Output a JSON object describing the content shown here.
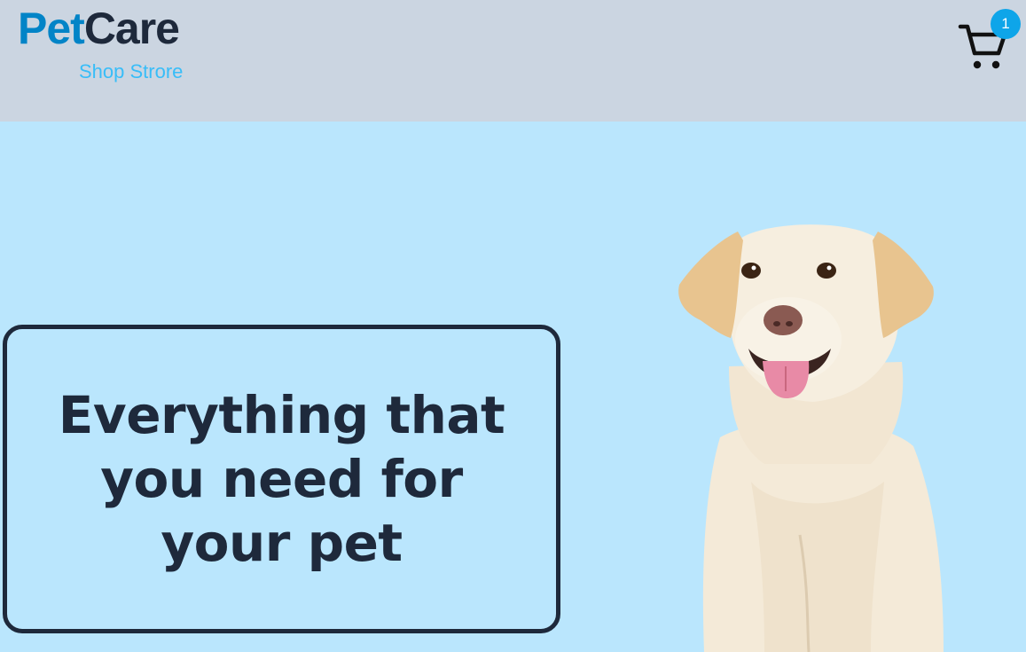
{
  "header": {
    "brand": {
      "part1": "Pet",
      "part2": "Care",
      "subtitle": "Shop Strore"
    },
    "cart": {
      "icon": "shopping-cart-icon",
      "count": "1"
    }
  },
  "hero": {
    "headline": "Everything that you need for your pet",
    "image": "labrador-dog-photo"
  },
  "colors": {
    "header_bg": "#cbd5e1",
    "hero_bg": "#bae6fd",
    "brand_blue": "#0284c7",
    "subtitle_blue": "#38bdf8",
    "badge_blue": "#0ea5e9",
    "dark_text": "#1e293b"
  }
}
